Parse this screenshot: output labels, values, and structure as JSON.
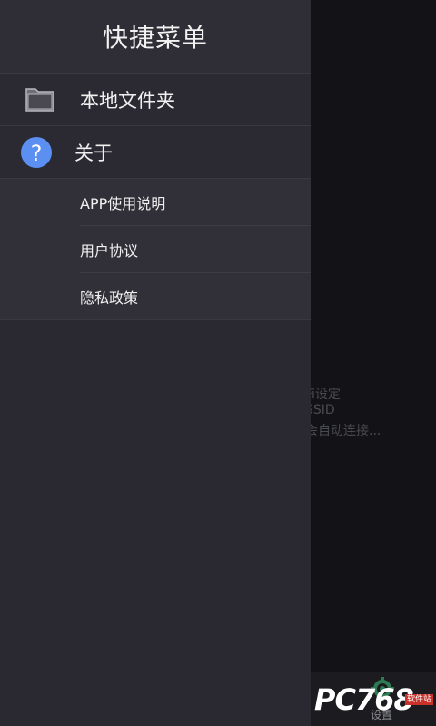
{
  "background": {
    "lines": [
      "Fi设定",
      "SSID",
      "会自动连接..."
    ],
    "bottom_settings": "设置",
    "watermark": "PC768",
    "watermark_tag": "软件站"
  },
  "drawer": {
    "title": "快捷菜单",
    "sections": [
      {
        "label": "本地文件夹",
        "icon": "folder-icon"
      },
      {
        "label": "关于",
        "icon": "question-icon"
      }
    ],
    "about_items": [
      {
        "label": "APP使用说明"
      },
      {
        "label": "用户协议"
      },
      {
        "label": "隐私政策"
      }
    ]
  },
  "colors": {
    "drawer_bg": "#2a2931",
    "header_bg": "#2f2e36",
    "accent_blue": "#5b8ff2",
    "text": "#f0f0f0"
  }
}
